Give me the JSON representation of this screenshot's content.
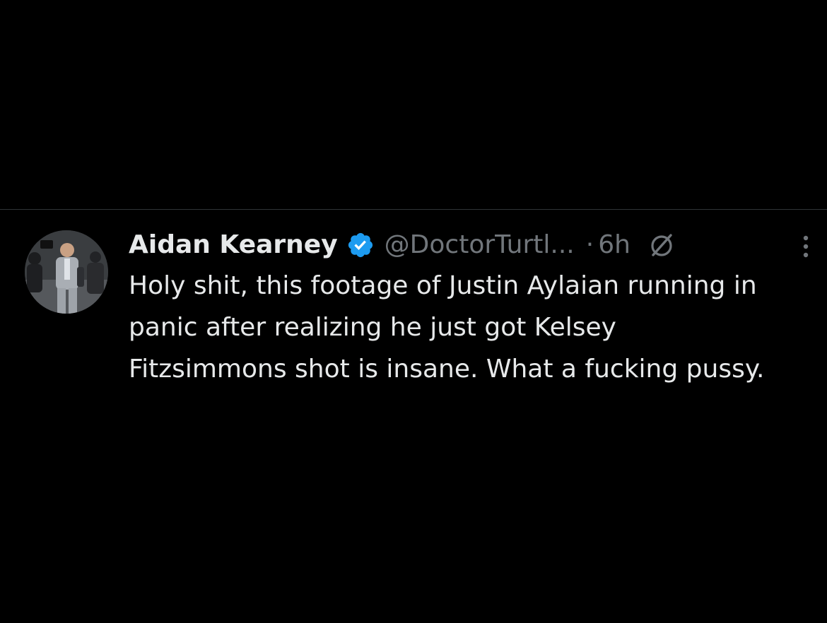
{
  "tweet": {
    "author_name": "Aidan Kearney",
    "handle": "@DoctorTurtl...",
    "separator": "·",
    "time": "6h",
    "text": "Holy shit, this footage of Justin Aylaian running in panic after realizing he just got Kelsey Fitzsimmons shot is insane. What a fucking pussy."
  },
  "icons": {
    "avatar": "avatar",
    "verified": "verified-badge-icon",
    "grok": "grok-icon",
    "more": "more-icon"
  },
  "colors": {
    "background": "#000000",
    "primary_text": "#e7e9ea",
    "secondary_text": "#71767b",
    "verified_blue": "#1d9bf0",
    "divider": "#2f3336"
  }
}
